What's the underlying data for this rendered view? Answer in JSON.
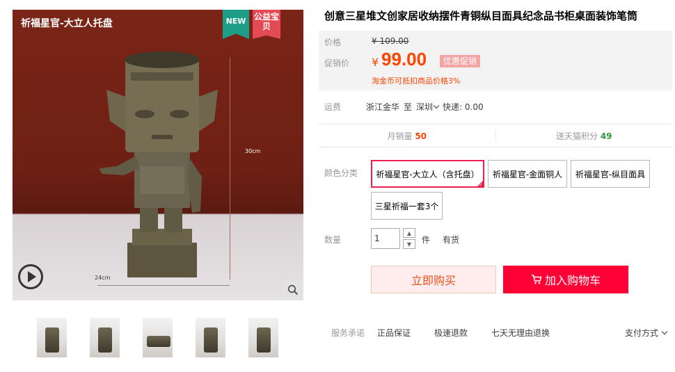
{
  "gallery": {
    "caption": "祈福星官-大立人托盘",
    "badge_new": "NEW",
    "badge_charity": "公益宝贝",
    "dim_height": "30cm",
    "dim_width": "24cm",
    "play_icon": "play-icon",
    "zoom_icon": "magnifier-icon",
    "thumbnail_count": 5
  },
  "product": {
    "title": "创意三星堆文创家居收纳摆件青铜纵目面具纪念品书柜桌面装饰笔筒"
  },
  "price": {
    "label": "价格",
    "original": "¥ 109.00",
    "promo_label": "促销价",
    "currency": "¥",
    "current": "99.00",
    "promo_tag": "优惠促销",
    "coin_note": "淘金币可抵扣商品价格3%"
  },
  "shipping": {
    "label": "运费",
    "from": "浙江金华",
    "to_word": "至",
    "to": "深圳",
    "express": "快递: 0.00"
  },
  "stats": {
    "monthly_sales_label": "月销量",
    "monthly_sales": "50",
    "points_label": "送天猫积分",
    "points": "49"
  },
  "sku": {
    "label": "颜色分类",
    "options": [
      "祈福星官-大立人（含托盘）",
      "祈福星官-金面铜人",
      "祈福星官-纵目面具",
      "三星祈福一套3个"
    ],
    "selected_index": 0
  },
  "quantity": {
    "label": "数量",
    "value": "1",
    "unit": "件",
    "stock": "有货"
  },
  "actions": {
    "buy_now": "立即购买",
    "add_to_cart": "加入购物车"
  },
  "service": {
    "label": "服务承诺",
    "items": [
      "正品保证",
      "极速退款",
      "七天无理由退换"
    ],
    "payment": "支付方式"
  },
  "colors": {
    "accent_red": "#ff0036",
    "price_orange": "#ff4400",
    "charity_red": "#e34a53",
    "new_green": "#1e9e87"
  }
}
